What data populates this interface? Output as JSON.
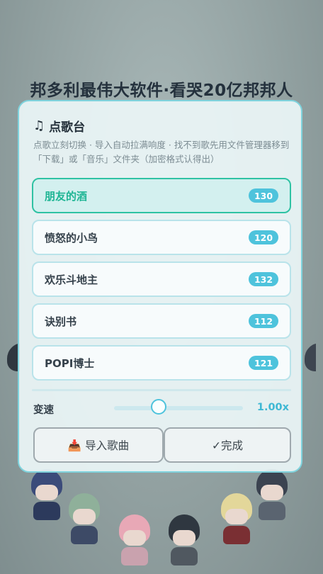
{
  "app": {
    "title": "邦多利最伟大软件·看哭20亿邦邦人"
  },
  "dialog": {
    "icon": "music-note-icon",
    "title": "点歌台",
    "description": "点歌立刻切换 · 导入自动拉满响度 · 找不到歌先用文件管理器移到「下载」或「音乐」文件夹（加密格式认得出）"
  },
  "songs": [
    {
      "name": "朋友的酒",
      "count": "130",
      "selected": true
    },
    {
      "name": "愤怒的小鸟",
      "count": "120"
    },
    {
      "name": "欢乐斗地主",
      "count": "132"
    },
    {
      "name": "诀别书",
      "count": "112"
    },
    {
      "name": "POPI博士",
      "count": "121"
    }
  ],
  "speed": {
    "label": "变速",
    "value": "1.00x",
    "level": 0.36
  },
  "buttons": {
    "import_icon": "inbox-tray-icon",
    "import_label": "📥 导入歌曲",
    "done_label": "✓完成"
  },
  "colors": {
    "accent": "#4ec3dc",
    "selected": "#1eb594",
    "border": "#7fd3dd"
  }
}
